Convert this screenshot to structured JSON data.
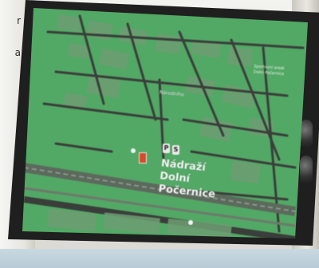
{
  "corner_text": [
    "r",
    "a"
  ],
  "map": {
    "station_name_lines": [
      "Nádraží",
      "Dolní",
      "Počernice"
    ],
    "street_label": "Národního",
    "badges": [
      "P",
      "S"
    ],
    "small_labels": [
      "Sportovní areál",
      "Dolní Počernice"
    ],
    "colors": {
      "map_green": "#52a865",
      "roads": "#3a3e3a",
      "buildings": "#6e9e73",
      "rail": "#5c6a5d",
      "marker": "#d84a2b"
    }
  }
}
